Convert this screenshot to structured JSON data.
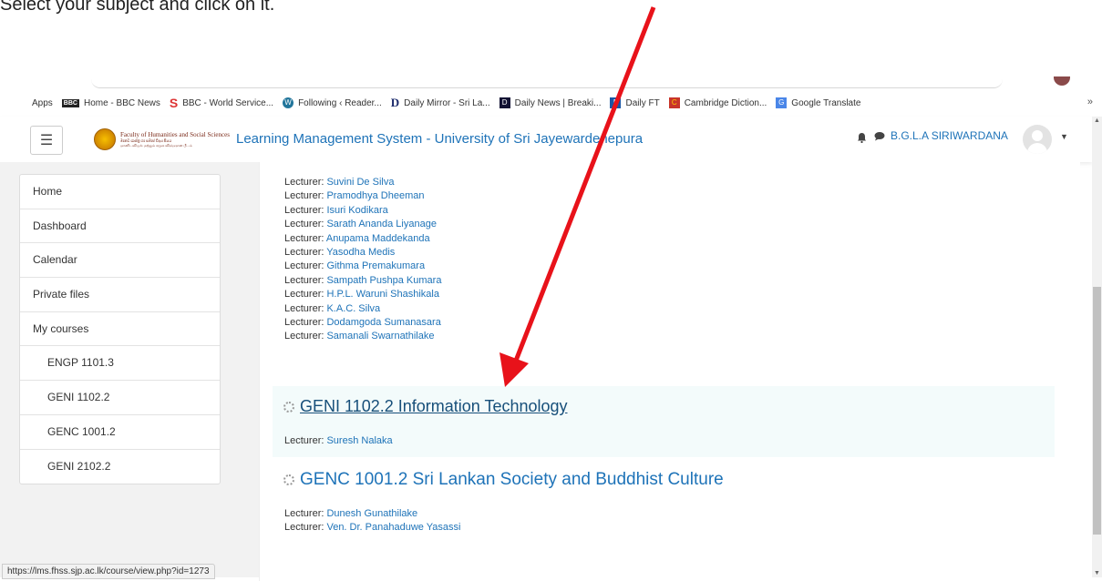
{
  "instruction": "Select your subject and click on it.",
  "bookmarks": [
    {
      "icon": "apps-grid-icon",
      "label": "Apps"
    },
    {
      "icon": "bbc-icon",
      "label": "Home - BBC News"
    },
    {
      "icon": "bbc-world-service-icon",
      "label": "BBC - World Service..."
    },
    {
      "icon": "wordpress-icon",
      "label": "Following ‹ Reader..."
    },
    {
      "icon": "daily-mirror-icon",
      "label": "Daily Mirror - Sri La..."
    },
    {
      "icon": "daily-news-icon",
      "label": "Daily News | Breaki..."
    },
    {
      "icon": "daily-ft-icon",
      "label": "Daily FT"
    },
    {
      "icon": "cambridge-icon",
      "label": "Cambridge Diction..."
    },
    {
      "icon": "google-translate-icon",
      "label": "Google Translate"
    }
  ],
  "bookmarks_overflow": "»",
  "navbar": {
    "menu_icon": "☰",
    "logo_line1": "Faculty of Humanities and Social Sciences",
    "logo_line2": "මානව ශාස්ත්‍ර හා සමාජ විද්‍යා පීඨය",
    "logo_line3": "மானிடவியல் மற்றும் சமூக விஞ்ஞான பீடம்",
    "site_title": "Learning Management System - University of Sri Jayewardenepura",
    "user_name": "B.G.L.A SIRIWARDANA"
  },
  "sidebar": {
    "items": [
      {
        "label": "Home"
      },
      {
        "label": "Dashboard"
      },
      {
        "label": "Calendar"
      },
      {
        "label": "Private files"
      },
      {
        "label": "My courses"
      },
      {
        "label": "ENGP 1101.3"
      },
      {
        "label": "GENI 1102.2"
      },
      {
        "label": "GENC 1001.2"
      },
      {
        "label": "GENI 2102.2"
      }
    ]
  },
  "status_url": "https://lms.fhss.sjp.ac.lk/course/view.php?id=1273",
  "lecturer_prefix": "Lecturer: ",
  "lecturers": [
    "Suvini De Silva",
    "Pramodhya Dheeman",
    "Isuri Kodikara",
    "Sarath Ananda Liyanage",
    "Anupama Maddekanda",
    "Yasodha Medis",
    "Githma Premakumara",
    "Sampath Pushpa Kumara",
    "H.P.L. Waruni Shashikala",
    "K.A.C. Silva",
    "Dodamgoda Sumanasara",
    "Samanali Swarnathilake"
  ],
  "courses": [
    {
      "title": "GENI 1102.2 Information Technology",
      "lecturers": [
        "Suresh Nalaka"
      ]
    },
    {
      "title": "GENC 1001.2 Sri Lankan Society and Buddhist Culture",
      "lecturers": [
        "Dunesh Gunathilake",
        "Ven. Dr. Panahaduwe Yasassi"
      ]
    }
  ],
  "colors": {
    "link": "#1e73b8",
    "arrow": "#e8121a",
    "highlight": "#f3fbfb"
  }
}
